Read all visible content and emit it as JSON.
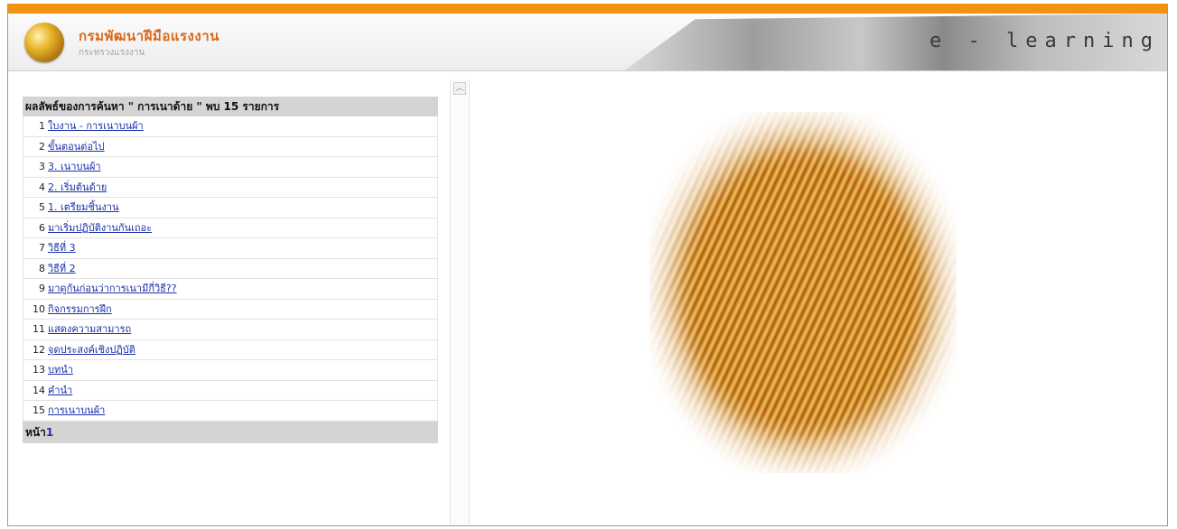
{
  "header": {
    "title": "กรมพัฒนาฝีมือแรงงาน",
    "subtitle": "กระทรวงแรงงาน",
    "banner_text": "e - learning"
  },
  "results": {
    "heading": "ผลลัพธ์ของการค้นหา \" การเนาด้าย \" พบ 15 รายการ",
    "items": [
      {
        "num": "1",
        "label": "ใบงาน - การเนาบนผ้า"
      },
      {
        "num": "2",
        "label": "ขั้นตอนต่อไป"
      },
      {
        "num": "3",
        "label": "3. เนาบนผ้า"
      },
      {
        "num": "4",
        "label": "2. เริ่มต้นด้าย"
      },
      {
        "num": "5",
        "label": "1. เตรียมชิ้นงาน"
      },
      {
        "num": "6",
        "label": "มาเริ่มปฏิบัติงานกันเถอะ"
      },
      {
        "num": "7",
        "label": "วิธีที่ 3"
      },
      {
        "num": "8",
        "label": "วิธีที่ 2"
      },
      {
        "num": "9",
        "label": "มาดูกันก่อนว่าการเนามีกี่วิธี??"
      },
      {
        "num": "10",
        "label": "กิจกรรมการฝึก"
      },
      {
        "num": "11",
        "label": "แสดงความสามารถ"
      },
      {
        "num": "12",
        "label": "จุดประสงค์เชิงปฏิบัติ"
      },
      {
        "num": "13",
        "label": "บทนำ"
      },
      {
        "num": "14",
        "label": "คำนำ"
      },
      {
        "num": "15",
        "label": "การเนาบนผ้า"
      }
    ],
    "footer_label": "หน้า",
    "footer_page": "1"
  },
  "icons": {
    "logo": "department-seal-icon",
    "scroll_up": "scroll-up-arrow-icon",
    "hero": "gears-image"
  },
  "colors": {
    "accent": "#f0940f",
    "title": "#d9681b",
    "link": "#1b2fa8"
  }
}
